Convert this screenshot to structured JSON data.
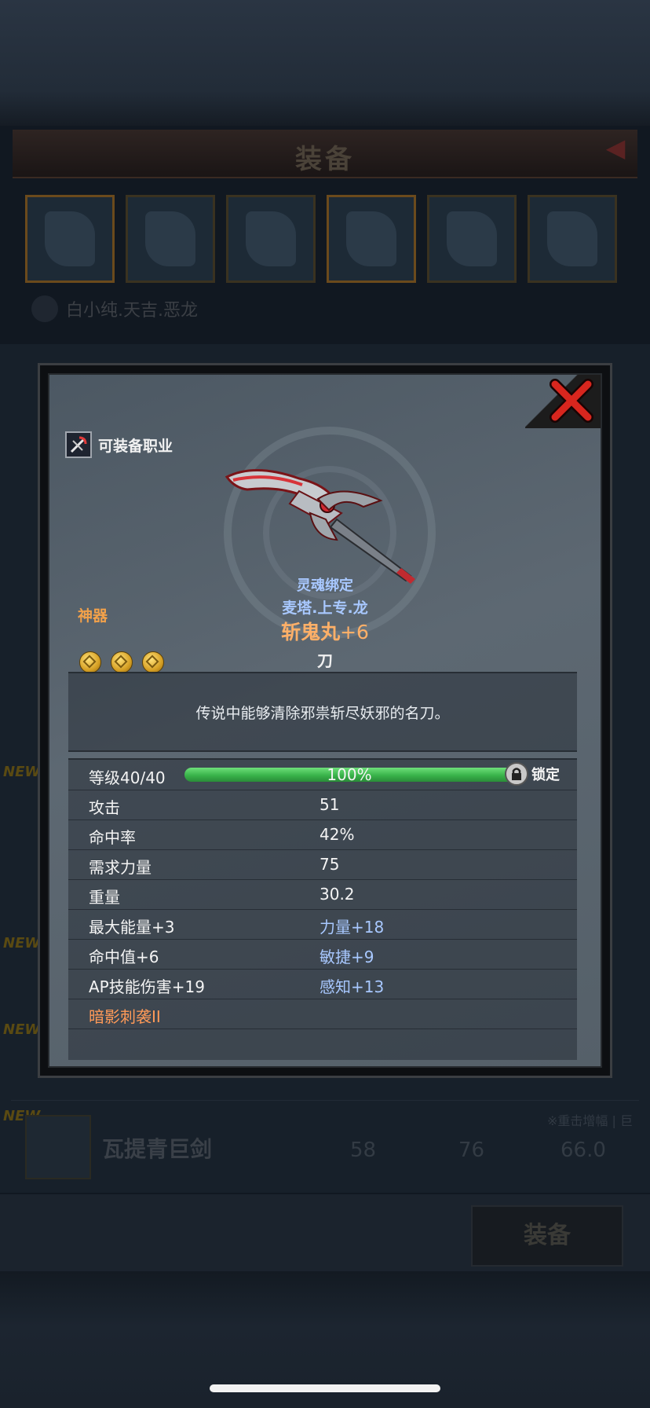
{
  "background": {
    "title": "装备",
    "character_name": "白小纯.天吉.恶龙",
    "new_badge": "NEW",
    "row_item_name": "瓦提青巨剑",
    "row_item_tag": "※重击增幅 | 巨",
    "row_values": [
      "58",
      "76",
      "66.0"
    ],
    "equip_button": "装备"
  },
  "dialog": {
    "job_label": "可装备职业",
    "rarity": "神器",
    "star_count": 3,
    "soulbound": "灵魂绑定",
    "owner": "麦塔.上专.龙",
    "item_name": "斩鬼丸",
    "item_plus": "+6",
    "item_type": "刀",
    "description": "传说中能够清除邪祟斩尽妖邪的名刀。",
    "level": {
      "label": "等级",
      "value": "40/40",
      "percent_text": "100%",
      "progress": 1.0,
      "lock_label": "锁定"
    },
    "stats": [
      {
        "label": "攻击",
        "value": "51"
      },
      {
        "label": "命中率",
        "value": "42%"
      },
      {
        "label": "需求力量",
        "value": "75"
      },
      {
        "label": "重量",
        "value": "30.2"
      }
    ],
    "bonuses": [
      {
        "left": "最大能量",
        "left_val": "+3",
        "right": "力量",
        "right_val": "+18"
      },
      {
        "left": "命中值",
        "left_val": "+6",
        "right": "敏捷",
        "right_val": "+9"
      },
      {
        "left": "AP技能伤害",
        "left_val": "+19",
        "right": "感知",
        "right_val": "+13"
      }
    ],
    "skill": "暗影刺袭II",
    "colors": {
      "rarity": "#f2a14a",
      "item_name": "#ffb068",
      "soulbound": "#a8c8ff",
      "skill": "#ff9a58",
      "level_bar": "#39b34a",
      "close_x": "#d8261e"
    },
    "icons": [
      "job-class-icon",
      "close-x-icon",
      "star-icon",
      "lock-icon"
    ]
  }
}
